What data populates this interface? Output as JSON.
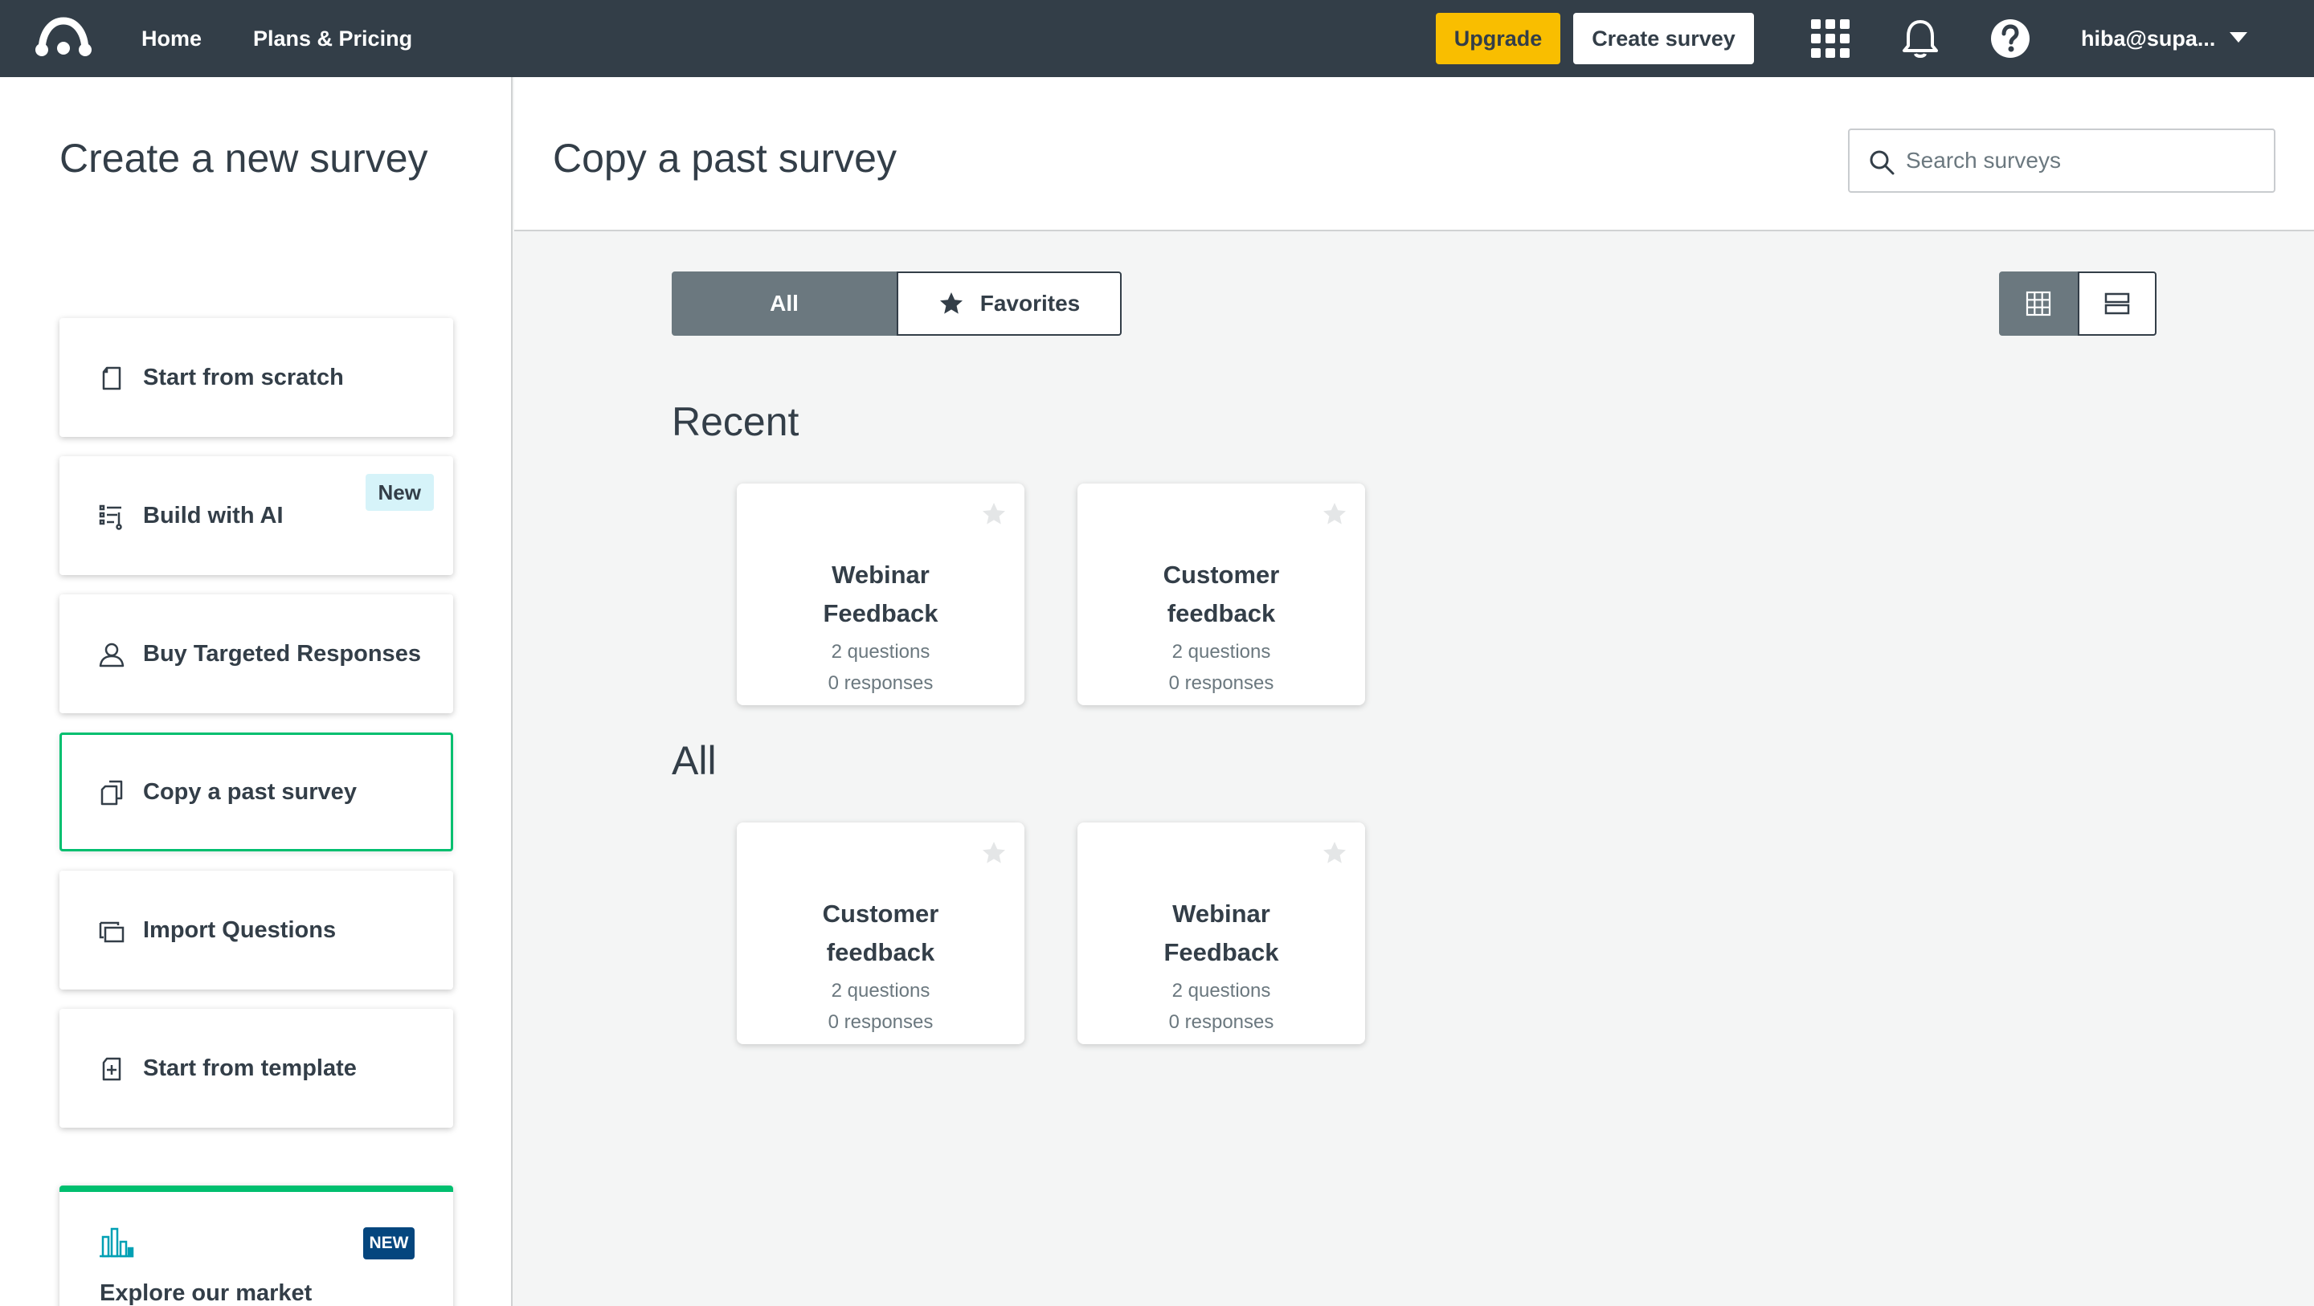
{
  "nav": {
    "home": "Home",
    "plans": "Plans & Pricing",
    "upgrade": "Upgrade",
    "create_survey": "Create survey",
    "user": "hiba@supa...",
    "icons": [
      "apps-grid-icon",
      "bell-icon",
      "help-icon"
    ]
  },
  "left": {
    "title": "Create a new survey",
    "options": [
      {
        "label": "Start from scratch",
        "icon": "blank-page-icon"
      },
      {
        "label": "Build with AI",
        "icon": "ai-build-icon",
        "badge": "New"
      },
      {
        "label": "Buy Targeted Responses",
        "icon": "person-icon"
      },
      {
        "label": "Copy a past survey",
        "icon": "copy-icon",
        "selected": true
      },
      {
        "label": "Import Questions",
        "icon": "import-icon"
      },
      {
        "label": "Start from template",
        "icon": "template-icon"
      }
    ],
    "market": {
      "badge": "NEW",
      "label": "Explore our market",
      "icon": "bar-chart-icon"
    }
  },
  "main": {
    "title": "Copy a past survey",
    "search_placeholder": "Search surveys",
    "filter": {
      "all": "All",
      "favorites": "Favorites",
      "selected": "All"
    },
    "view": {
      "selected": "grid"
    },
    "sections": [
      {
        "title": "Recent",
        "cards": [
          {
            "title_line1": "Webinar",
            "title_line2": "Feedback",
            "questions": "2 questions",
            "responses": "0 responses"
          },
          {
            "title_line1": "Customer",
            "title_line2": "feedback",
            "questions": "2 questions",
            "responses": "0 responses"
          }
        ]
      },
      {
        "title": "All",
        "cards": [
          {
            "title_line1": "Customer",
            "title_line2": "feedback",
            "questions": "2 questions",
            "responses": "0 responses"
          },
          {
            "title_line1": "Webinar",
            "title_line2": "Feedback",
            "questions": "2 questions",
            "responses": "0 responses"
          }
        ]
      }
    ]
  },
  "colors": {
    "nav_bg": "#333e48",
    "accent_green": "#00bf6f",
    "upgrade_yellow": "#f9be00",
    "toggle_active": "#6b787f",
    "badge_new_bg": "#d6f3f9",
    "market_badge_bg": "#05467e"
  }
}
